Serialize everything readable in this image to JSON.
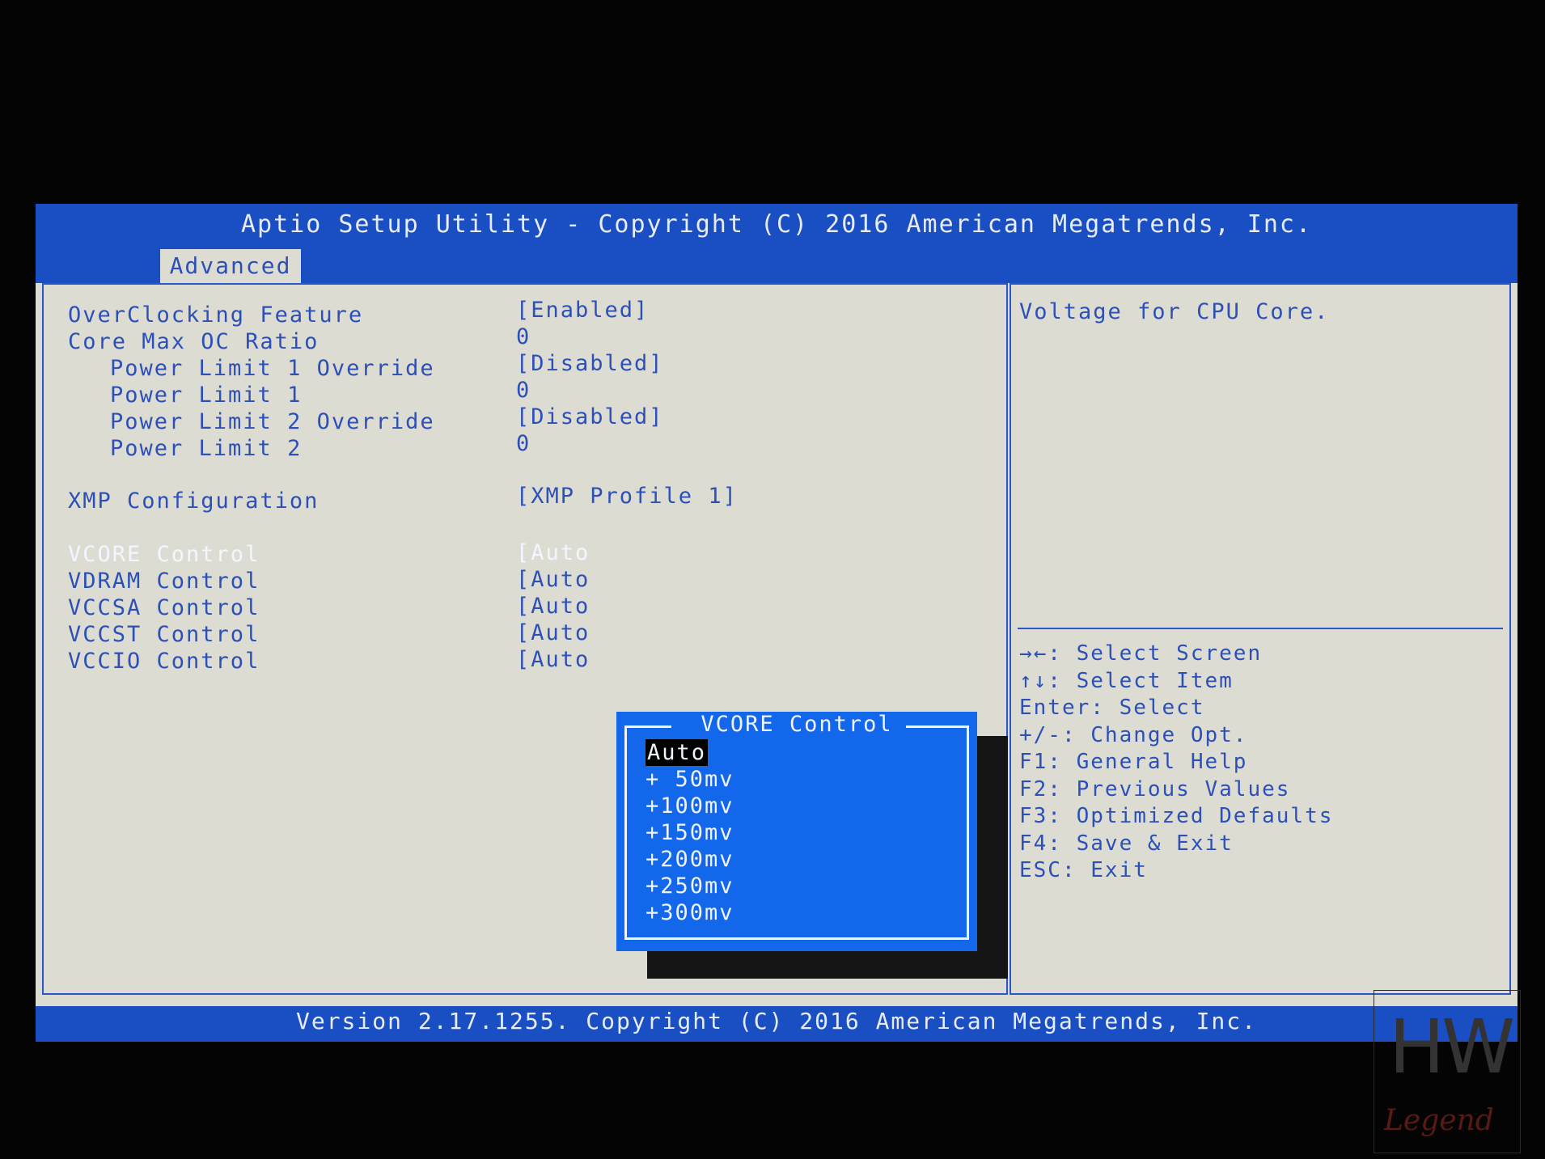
{
  "header": {
    "title": "Aptio Setup Utility - Copyright (C) 2016 American Megatrends, Inc.",
    "tab": "Advanced"
  },
  "settings": [
    {
      "label": "OverClocking Feature",
      "value": "[Enabled]",
      "indent": 0
    },
    {
      "label": "Core Max OC Ratio",
      "value": "0",
      "indent": 0
    },
    {
      "label": "Power Limit 1 Override",
      "value": "[Disabled]",
      "indent": 1
    },
    {
      "label": "Power Limit 1",
      "value": "0",
      "indent": 1
    },
    {
      "label": "Power Limit 2 Override",
      "value": "[Disabled]",
      "indent": 1
    },
    {
      "label": "Power Limit 2",
      "value": "0",
      "indent": 1
    },
    {
      "label": "XMP Configuration",
      "value": "[XMP Profile 1]",
      "indent": 0
    },
    {
      "label": "VCORE Control",
      "value": "[Auto",
      "indent": 0
    },
    {
      "label": "VDRAM Control",
      "value": "[Auto",
      "indent": 0
    },
    {
      "label": "VCCSA Control",
      "value": "[Auto",
      "indent": 0
    },
    {
      "label": "VCCST Control",
      "value": "[Auto",
      "indent": 0
    },
    {
      "label": "VCCIO Control",
      "value": "[Auto",
      "indent": 0
    }
  ],
  "help": {
    "description": "Voltage for CPU Core.",
    "keys": [
      "→←: Select Screen",
      "↑↓: Select Item",
      "Enter: Select",
      "+/-: Change Opt.",
      "F1: General Help",
      "F2: Previous Values",
      "F3: Optimized Defaults",
      "F4: Save & Exit",
      "ESC: Exit"
    ]
  },
  "popup": {
    "title": "VCORE Control",
    "options": [
      "Auto",
      "+ 50mv",
      "+100mv",
      "+150mv",
      "+200mv",
      "+250mv",
      "+300mv"
    ],
    "selected_index": 0
  },
  "footer": {
    "version": "Version 2.17.1255. Copyright (C) 2016 American Megatrends, Inc."
  },
  "watermark": {
    "text_top": "HW",
    "text_bottom": "Legend"
  },
  "colors": {
    "bios_blue": "#1a4fc4",
    "bios_gray": "#dcdcd2",
    "text_blue": "#2c50b8",
    "popup_blue": "#1267ea"
  }
}
